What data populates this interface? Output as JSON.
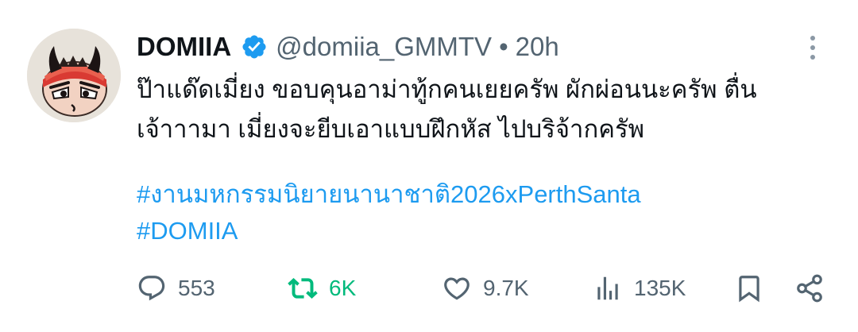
{
  "author": {
    "name": "DOMIIA",
    "handle": "@domiia_GMMTV",
    "separator": "•",
    "time": "20h"
  },
  "tweet": {
    "lines": [
      "ป๊าแด๊ดเมี่ยง ขอบคุนอาม่าทู้กคนเยยครัพ ผักผ่อนนะครัพ ตื่น",
      "เจ้าาามา เมี่ยงจะยีบเอาแบบฝึกหัส ไปบริจ้ากครัพ"
    ],
    "hashtags": [
      "#งานมหกรรมนิยายนานาชาติ2026xPerthSanta",
      "#DOMIIA"
    ]
  },
  "actions": {
    "replies": "553",
    "retweets": "6K",
    "likes": "9.7K",
    "views": "135K"
  },
  "colors": {
    "link": "#1d9bf0",
    "retweet_active": "#00ba7c",
    "secondary_text": "#536471",
    "verified_badge": "#1d9bf0"
  },
  "icons": {
    "reply": "reply-icon",
    "retweet": "retweet-icon",
    "like": "heart-icon",
    "views": "views-icon",
    "bookmark": "bookmark-icon",
    "share": "share-icon",
    "more": "more-icon",
    "verified": "verified-badge-icon"
  }
}
